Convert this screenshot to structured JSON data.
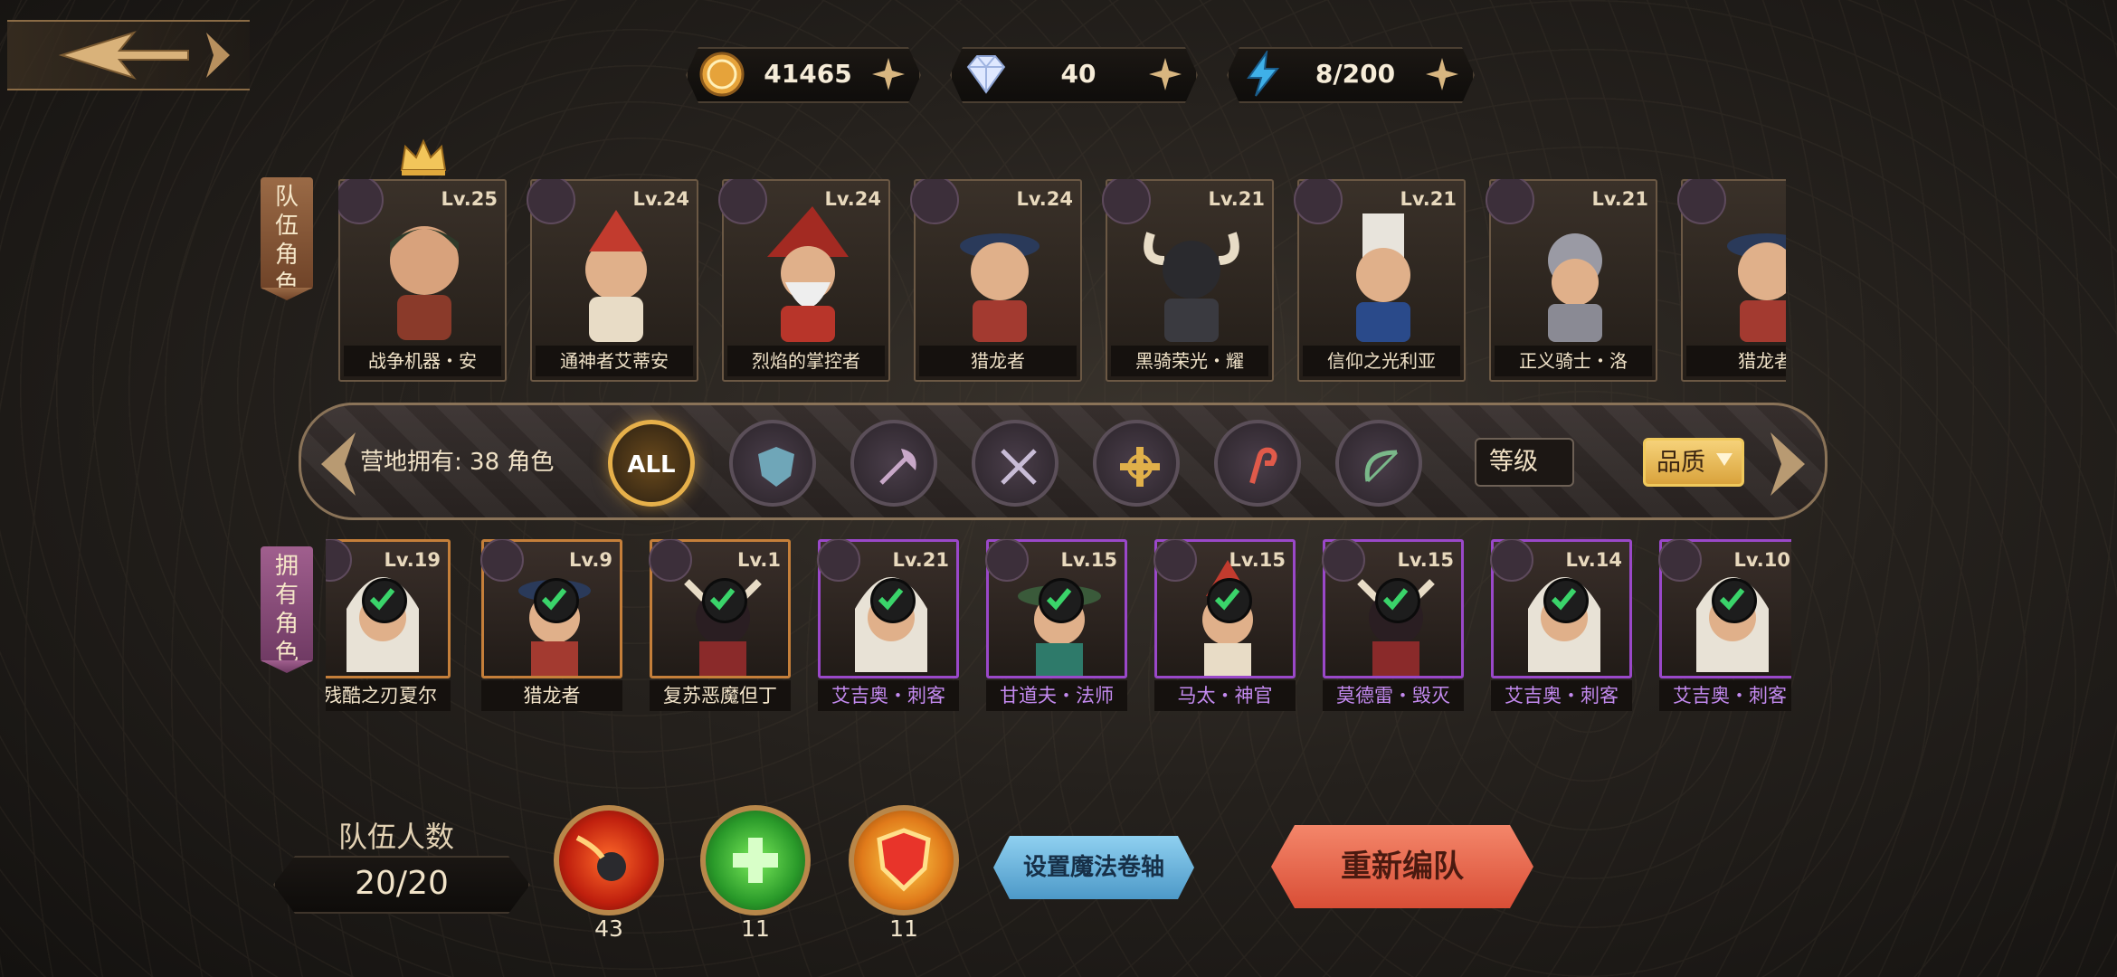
{
  "resources": [
    {
      "icon": "gold-coin-icon",
      "value": "41465"
    },
    {
      "icon": "diamond-icon",
      "value": "40"
    },
    {
      "icon": "energy-bolt-icon",
      "value": "8/200"
    }
  ],
  "side_tabs": {
    "team": "队伍角色",
    "owned": "拥有角色"
  },
  "team_members": [
    {
      "level": "Lv.25",
      "name": "战争机器・安",
      "class_icon": "axe-class-icon",
      "leader": true
    },
    {
      "level": "Lv.24",
      "name": "通神者艾蒂安",
      "class_icon": "priest-class-icon"
    },
    {
      "level": "Lv.24",
      "name": "烈焰的掌控者",
      "class_icon": "mage-class-icon"
    },
    {
      "level": "Lv.24",
      "name": "猎龙者",
      "class_icon": "bow-class-icon"
    },
    {
      "level": "Lv.21",
      "name": "黑骑荣光・耀",
      "class_icon": "shield-class-icon"
    },
    {
      "level": "Lv.21",
      "name": "信仰之光利亚",
      "class_icon": "priest-class-icon"
    },
    {
      "level": "Lv.21",
      "name": "正义骑士・洛",
      "class_icon": "shield-class-icon"
    },
    {
      "level": "",
      "name": "猎龙者",
      "class_icon": "bow-class-icon"
    }
  ],
  "filter": {
    "owned_text": "营地拥有: 38 角色",
    "all_label": "ALL",
    "class_filters": [
      "shield-class-icon",
      "axe-class-icon",
      "swords-class-icon",
      "priest-class-icon",
      "mage-class-icon",
      "bow-class-icon"
    ],
    "sort_level": "等级",
    "sort_quality": "品质"
  },
  "owned_characters": [
    {
      "level": "Lv.19",
      "name": "残酷之刃夏尔",
      "rarity": "orange",
      "class_icon": "axe-class-icon"
    },
    {
      "level": "Lv.9",
      "name": "猎龙者",
      "rarity": "orange",
      "class_icon": "bow-class-icon"
    },
    {
      "level": "Lv.1",
      "name": "复苏恶魔但丁",
      "rarity": "orange",
      "class_icon": "axe-class-icon"
    },
    {
      "level": "Lv.21",
      "name": "艾吉奥・刺客",
      "rarity": "purple",
      "class_icon": "swords-class-icon"
    },
    {
      "level": "Lv.15",
      "name": "甘道夫・法师",
      "rarity": "purple",
      "class_icon": "mage-class-icon"
    },
    {
      "level": "Lv.15",
      "name": "马太・神官",
      "rarity": "purple",
      "class_icon": "priest-class-icon"
    },
    {
      "level": "Lv.15",
      "name": "莫德雷・毁灭",
      "rarity": "purple",
      "class_icon": "axe-class-icon"
    },
    {
      "level": "Lv.14",
      "name": "艾吉奥・刺客",
      "rarity": "purple",
      "class_icon": "swords-class-icon"
    },
    {
      "level": "Lv.10",
      "name": "艾吉奥・刺客",
      "rarity": "purple",
      "class_icon": "swords-class-icon"
    }
  ],
  "team_size": {
    "label": "队伍人数",
    "value": "20/20"
  },
  "skills": [
    {
      "icon": "fireball-skill-icon",
      "count": "43"
    },
    {
      "icon": "heal-skill-icon",
      "count": "11"
    },
    {
      "icon": "shield-skill-icon",
      "count": "11"
    }
  ],
  "buttons": {
    "magic_scroll": "设置魔法卷轴",
    "reform_team": "重新编队"
  },
  "colors": {
    "gold": "#e6b04a",
    "orange_rarity": "#c57f3a",
    "purple_rarity": "#9a48c9",
    "reform": "#e0604a",
    "magic": "#6cb4df"
  }
}
